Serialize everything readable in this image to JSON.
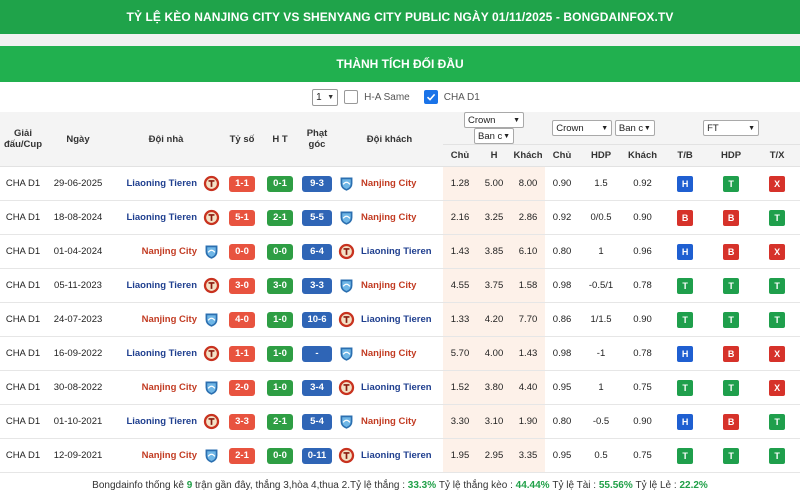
{
  "banner": {
    "title": "TỶ LỆ KÈO NANJING CITY VS SHENYANG CITY PUBLIC NGÀY 01/11/2025 - BONGDAINFOX.TV"
  },
  "section": {
    "title": "THÀNH TÍCH ĐỐI ĐẦU"
  },
  "controls": {
    "count_value": "1",
    "ha_same_label": "H-A Same",
    "ha_same_checked": false,
    "league_label": "CHA D1",
    "league_checked": true
  },
  "columns": {
    "league": "Giải đấu/Cup",
    "date": "Ngày",
    "home": "Đội nhà",
    "score": "Tỷ số",
    "ht": "H T",
    "corner": "Phạt góc",
    "away": "Đội khách",
    "odds1_select": "Crown",
    "odds1_type_select": "Ban c",
    "odds2_select": "Crown",
    "odds2_type_select": "Ban c",
    "result_select": "FT",
    "o1_home": "Chủ",
    "o1_draw": "H",
    "o1_away": "Khách",
    "o2_home": "Chủ",
    "o2_hdp": "HDP",
    "o2_away": "Khách",
    "r_tb": "T/B",
    "r_hdp": "HDP",
    "r_tx": "T/X"
  },
  "team_colors": {
    "Liaoning Tieren": "#1f3f8f",
    "Nanjing City": "#c23b22"
  },
  "rows": [
    {
      "league": "CHA D1",
      "date": "29-06-2025",
      "home": "Liaoning Tieren",
      "score": "1-1",
      "ht": "0-1",
      "corner": "9-3",
      "away": "Nanjing City",
      "o1": [
        "1.28",
        "5.00",
        "8.00"
      ],
      "o2": [
        "0.90",
        "1.5",
        "0.92"
      ],
      "res": [
        "H",
        "T",
        "X"
      ]
    },
    {
      "league": "CHA D1",
      "date": "18-08-2024",
      "home": "Liaoning Tieren",
      "score": "5-1",
      "ht": "2-1",
      "corner": "5-5",
      "away": "Nanjing City",
      "o1": [
        "2.16",
        "3.25",
        "2.86"
      ],
      "o2": [
        "0.92",
        "0/0.5",
        "0.90"
      ],
      "res": [
        "B",
        "B",
        "T"
      ]
    },
    {
      "league": "CHA D1",
      "date": "01-04-2024",
      "home": "Nanjing City",
      "score": "0-0",
      "ht": "0-0",
      "corner": "6-4",
      "away": "Liaoning Tieren",
      "o1": [
        "1.43",
        "3.85",
        "6.10"
      ],
      "o2": [
        "0.80",
        "1",
        "0.96"
      ],
      "res": [
        "H",
        "B",
        "X"
      ]
    },
    {
      "league": "CHA D1",
      "date": "05-11-2023",
      "home": "Liaoning Tieren",
      "score": "3-0",
      "ht": "3-0",
      "corner": "3-3",
      "away": "Nanjing City",
      "o1": [
        "4.55",
        "3.75",
        "1.58"
      ],
      "o2": [
        "0.98",
        "-0.5/1",
        "0.78"
      ],
      "res": [
        "T",
        "T",
        "T"
      ]
    },
    {
      "league": "CHA D1",
      "date": "24-07-2023",
      "home": "Nanjing City",
      "score": "4-0",
      "ht": "1-0",
      "corner": "10-6",
      "away": "Liaoning Tieren",
      "o1": [
        "1.33",
        "4.20",
        "7.70"
      ],
      "o2": [
        "0.86",
        "1/1.5",
        "0.90"
      ],
      "res": [
        "T",
        "T",
        "T"
      ]
    },
    {
      "league": "CHA D1",
      "date": "16-09-2022",
      "home": "Liaoning Tieren",
      "score": "1-1",
      "ht": "1-0",
      "corner": "-",
      "away": "Nanjing City",
      "o1": [
        "5.70",
        "4.00",
        "1.43"
      ],
      "o2": [
        "0.98",
        "-1",
        "0.78"
      ],
      "res": [
        "H",
        "B",
        "X"
      ]
    },
    {
      "league": "CHA D1",
      "date": "30-08-2022",
      "home": "Nanjing City",
      "score": "2-0",
      "ht": "1-0",
      "corner": "3-4",
      "away": "Liaoning Tieren",
      "o1": [
        "1.52",
        "3.80",
        "4.40"
      ],
      "o2": [
        "0.95",
        "1",
        "0.75"
      ],
      "res": [
        "T",
        "T",
        "X"
      ]
    },
    {
      "league": "CHA D1",
      "date": "01-10-2021",
      "home": "Liaoning Tieren",
      "score": "3-3",
      "ht": "2-1",
      "corner": "5-4",
      "away": "Nanjing City",
      "o1": [
        "3.30",
        "3.10",
        "1.90"
      ],
      "o2": [
        "0.80",
        "-0.5",
        "0.90"
      ],
      "res": [
        "H",
        "B",
        "T"
      ]
    },
    {
      "league": "CHA D1",
      "date": "12-09-2021",
      "home": "Nanjing City",
      "score": "2-1",
      "ht": "0-0",
      "corner": "0-11",
      "away": "Liaoning Tieren",
      "o1": [
        "1.95",
        "2.95",
        "3.35"
      ],
      "o2": [
        "0.95",
        "0.5",
        "0.75"
      ],
      "res": [
        "T",
        "T",
        "T"
      ]
    }
  ],
  "summary": {
    "prefix": "Bongdainfo thống kê",
    "matches": "9",
    "text1": "trận gần đây, thắng 3,hòa 4,thua 2.Tỷ lệ thắng :",
    "win_rate": "33.3%",
    "text2": "Tỷ lệ thắng kèo :",
    "handicap_rate": "44.44%",
    "text3": "Tỷ lệ Tài :",
    "over_rate": "55.56%",
    "text4": "Tỷ lệ Lẻ :",
    "odd_rate": "22.2%"
  }
}
